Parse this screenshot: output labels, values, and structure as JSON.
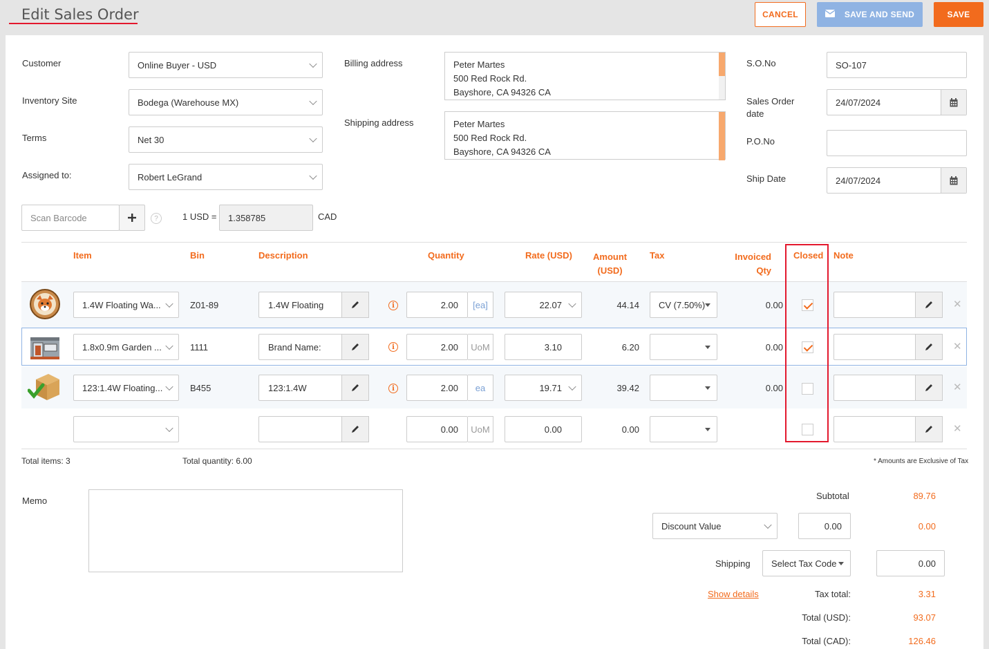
{
  "header": {
    "title": "Edit Sales Order",
    "cancel_label": "CANCEL",
    "save_and_send_label": "SAVE AND SEND",
    "save_label": "SAVE"
  },
  "form": {
    "customer": {
      "label": "Customer",
      "value": "Online Buyer - USD"
    },
    "inventory_site": {
      "label": "Inventory Site",
      "value": "Bodega (Warehouse MX)"
    },
    "terms": {
      "label": "Terms",
      "value": "Net 30"
    },
    "assigned_to": {
      "label": "Assigned to:",
      "value": "Robert LeGrand"
    },
    "billing_address": {
      "label": "Billing address",
      "lines": [
        "Peter Martes",
        "500 Red Rock Rd.",
        "Bayshore, CA 94326 CA"
      ]
    },
    "shipping_address": {
      "label": "Shipping address",
      "lines": [
        "Peter Martes",
        "500 Red Rock Rd.",
        "Bayshore, CA 94326 CA"
      ]
    },
    "so_no": {
      "label": "S.O.No",
      "value": "SO-107"
    },
    "sales_order_date": {
      "label_line1": "Sales Order",
      "label_line2": "date",
      "value": "24/07/2024"
    },
    "po_no": {
      "label": "P.O.No",
      "value": ""
    },
    "ship_date": {
      "label": "Ship Date",
      "value": "24/07/2024"
    },
    "scan_barcode_placeholder": "Scan Barcode",
    "exchange_label": "1 USD =",
    "exchange_rate": "1.358785",
    "exchange_currency": "CAD"
  },
  "table": {
    "headers": {
      "item": "Item",
      "bin": "Bin",
      "description": "Description",
      "quantity": "Quantity",
      "rate": "Rate (USD)",
      "amount_l1": "Amount",
      "amount_l2": "(USD)",
      "tax": "Tax",
      "invoiced_l1": "Invoiced",
      "invoiced_l2": "Qty",
      "closed": "Closed",
      "note": "Note"
    },
    "rows": [
      {
        "item": "1.4W Floating Wa...",
        "bin": "Z01-89",
        "description": "1.4W Floating",
        "quantity": "2.00",
        "unit": "[ea]",
        "rate": "22.07",
        "amount": "44.14",
        "tax": "CV (7.50%)",
        "invoiced": "0.00",
        "closed": true,
        "thumb": "fox-logo"
      },
      {
        "item": "1.8x0.9m Garden ...",
        "bin": "1111",
        "description": "Brand Name:",
        "quantity": "2.00",
        "unit": "UoM",
        "rate": "3.10",
        "amount": "6.20",
        "tax": "",
        "invoiced": "0.00",
        "closed": true,
        "thumb": "garden-shed"
      },
      {
        "item": "123:1.4W Floating...",
        "bin": "B455",
        "description": "123:1.4W",
        "quantity": "2.00",
        "unit": "ea",
        "rate": "19.71",
        "amount": "39.42",
        "tax": "",
        "invoiced": "0.00",
        "closed": false,
        "thumb": "box-check"
      },
      {
        "item": "",
        "bin": "",
        "description": "",
        "quantity": "0.00",
        "unit": "UoM",
        "rate": "0.00",
        "amount": "0.00",
        "tax": "",
        "invoiced": "",
        "closed": false,
        "thumb": ""
      }
    ]
  },
  "summary": {
    "total_items": "Total items: 3",
    "total_quantity": "Total quantity: 6.00",
    "tax_note": "* Amounts are Exclusive of Tax",
    "memo_label": "Memo",
    "subtotal_label": "Subtotal",
    "subtotal_value": "89.76",
    "discount_select": "Discount Value",
    "discount_input": "0.00",
    "discount_value": "0.00",
    "shipping_label": "Shipping",
    "shipping_tax_select": "Select Tax Code",
    "shipping_input": "0.00",
    "show_details": "Show details",
    "tax_total_label": "Tax total:",
    "tax_total_value": "3.31",
    "total_usd_label": "Total (USD):",
    "total_usd_value": "93.07",
    "total_cad_label": "Total (CAD):",
    "total_cad_value": "126.46"
  },
  "colors": {
    "accent": "#f26b1d",
    "highlight": "#e3182d",
    "save_and_send": "#8fb3e3"
  }
}
